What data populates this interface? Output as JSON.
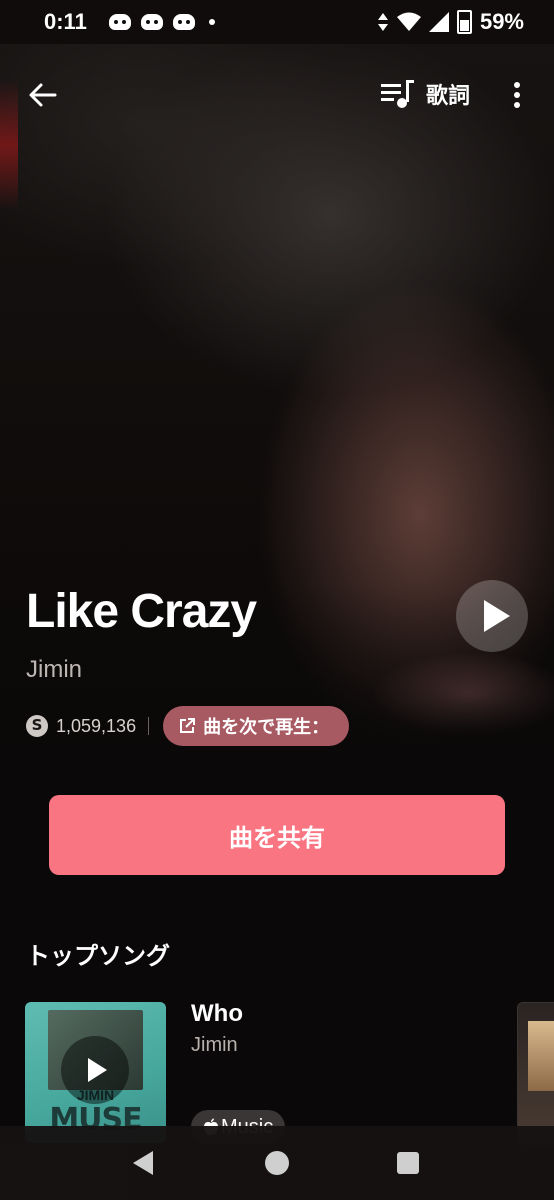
{
  "status_bar": {
    "time": "0:11",
    "battery": "59%",
    "notification_icons": [
      "discord-icon",
      "discord-icon",
      "discord-icon",
      "dot-icon"
    ],
    "system_icons": [
      "data-arrows-icon",
      "wifi-icon",
      "signal-icon",
      "battery-icon"
    ]
  },
  "topbar": {
    "lyrics_label": "歌詞"
  },
  "song": {
    "title": "Like Crazy",
    "artist": "Jimin",
    "shazam_count": "1,059,136",
    "play_next_label": "曲を次で再生："
  },
  "actions": {
    "share_label": "曲を共有"
  },
  "top_songs": {
    "heading": "トップソング",
    "items": [
      {
        "title": "Who",
        "artist": "Jimin",
        "badge": "Music",
        "art_text": "MUSE",
        "art_subtext": "JIMIN"
      }
    ]
  },
  "colors": {
    "accent": "#fa7582",
    "pill": "#a85a63",
    "background": "#0a0808"
  }
}
